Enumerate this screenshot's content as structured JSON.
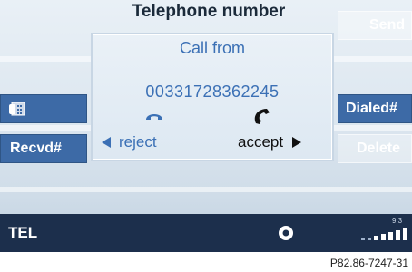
{
  "header": {
    "title": "Telephone number"
  },
  "popup": {
    "title": "Call from",
    "number": "00331728362245",
    "reject_label": "reject",
    "accept_label": "accept"
  },
  "left_buttons": {
    "recvd_label": "Recvd#"
  },
  "right_buttons": {
    "send_label": "Send",
    "dialed_label": "Dialed#",
    "delete_label": "Delete"
  },
  "status_bar": {
    "mode": "TEL",
    "time": "9:3"
  },
  "caption": "P82.86-7247-31",
  "colors": {
    "accent_blue": "#3b70b5",
    "button_blue": "#3d6aa6",
    "status_bar": "#1c2f4c"
  }
}
